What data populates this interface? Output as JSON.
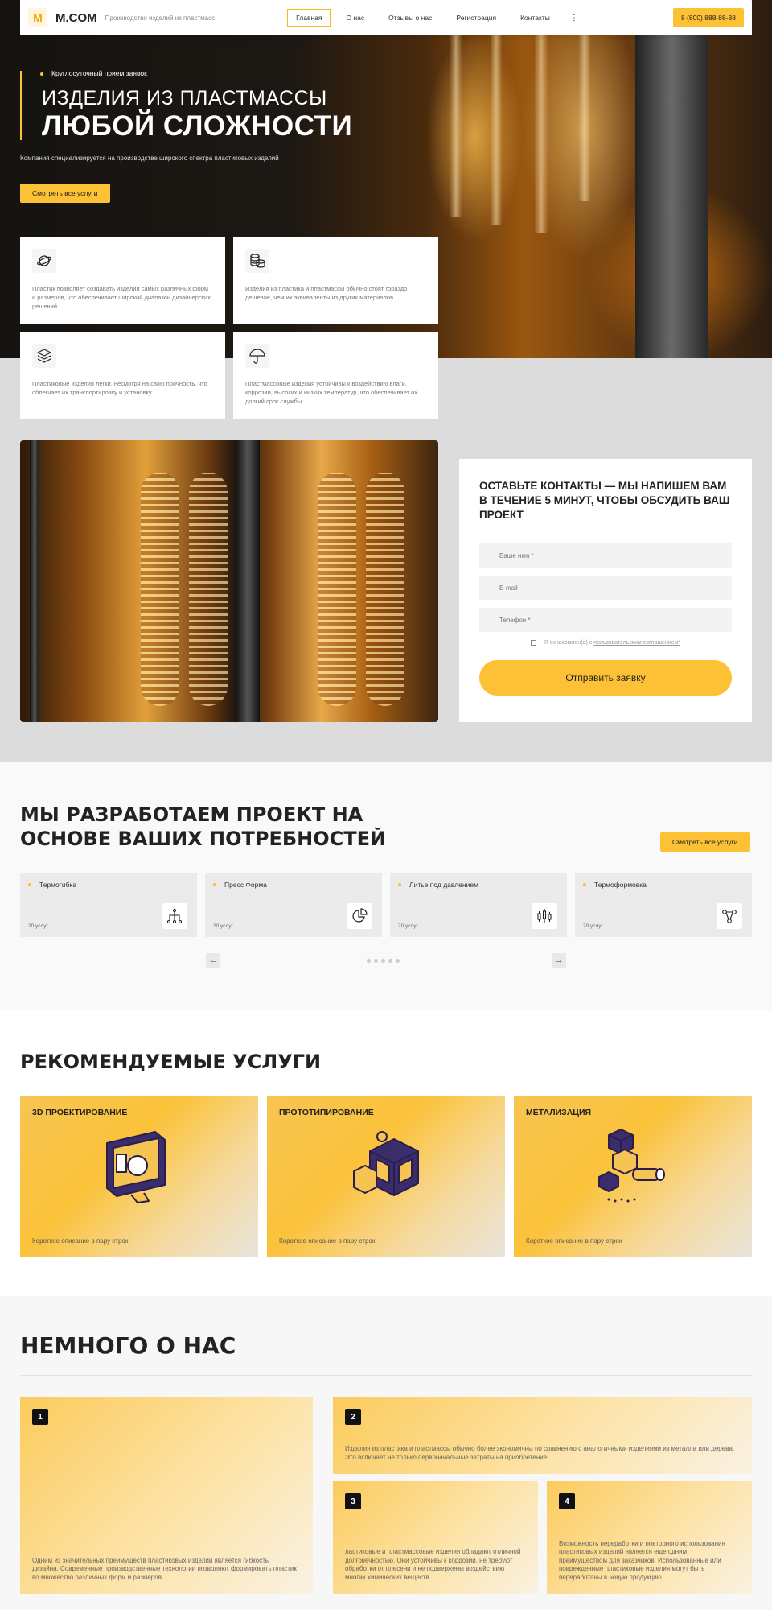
{
  "header": {
    "logo_mark": "M",
    "logo_text": "M.COM",
    "tagline": "Производство изделий из пластмасс",
    "nav": [
      "Главная",
      "О нас",
      "Отзывы о нас",
      "Регистрация",
      "Контакты"
    ],
    "more": "⋮",
    "phone": "8 (800) 888-88-88"
  },
  "hero": {
    "badge": "Круглосуточный прием заявок",
    "title_line1": "ИЗДЕЛИЯ ИЗ ПЛАСТМАССЫ",
    "title_line2": "ЛЮБОЙ СЛОЖНОСТИ",
    "description": "Компания специализируется на производстве широкого спектра пластиковых изделий",
    "button": "Смотреть все услуги"
  },
  "features": [
    {
      "icon": "planet-icon",
      "text": "Пластик позволяет создавать изделия самых различных форм и размеров, что обеспечивает широкий диапазон дизайнерских решений."
    },
    {
      "icon": "coins-icon",
      "text": "Изделия из пластика и пластмассы обычно стоят гораздо дешевле, чем их эквиваленты из других материалов."
    },
    {
      "icon": "layers-icon",
      "text": "Пластиковые изделия легки, несмотря на свою прочность, что облегчает их транспортировку и установку."
    },
    {
      "icon": "umbrella-icon",
      "text": "Пластмассовые изделия устойчивы к воздействию влаги, коррозии, высоких и низких температур, что обеспечивает их долгий срок службы."
    }
  ],
  "form": {
    "title": "ОСТАВЬТЕ КОНТАКТЫ — МЫ НАПИШЕМ ВАМ В ТЕЧЕНИЕ 5 МИНУТ, ЧТОБЫ ОБСУДИТЬ ВАШ ПРОЕКТ",
    "name_placeholder": "Ваше имя *",
    "email_placeholder": "E-mail",
    "phone_placeholder": "Телефон *",
    "consent_text": "Я ознакомлен(а) с",
    "consent_link": "пользовательским соглашением*",
    "submit": "Отправить заявку"
  },
  "projects": {
    "title_line1": "МЫ РАЗРАБОТАЕМ ПРОЕКТ НА",
    "title_line2": "ОСНОВЕ ВАШИХ ПОТРЕБНОСТЕЙ",
    "button": "Смотреть все услуги",
    "cards": [
      {
        "title": "Термогибка",
        "count": "20 услуг",
        "icon": "circuit-icon"
      },
      {
        "title": "Пресс Форма",
        "count": "20 услуг",
        "icon": "pie-chart-icon"
      },
      {
        "title": "Литье под давлением",
        "count": "20 услуг",
        "icon": "candlestick-icon"
      },
      {
        "title": "Термоформовка",
        "count": "20 услуг",
        "icon": "network-icon"
      }
    ],
    "prev": "←",
    "next": "→"
  },
  "services": {
    "title": "РЕКОМЕНДУЕМЫЕ УСЛУГИ",
    "cards": [
      {
        "title": "3D ПРОЕКТИРОВАНИЕ",
        "description": "Короткое описание в пару строк"
      },
      {
        "title": "ПРОТОТИПИРОВАНИЕ",
        "description": "Короткое описание в пару строк"
      },
      {
        "title": "МЕТАЛИЗАЦИЯ",
        "description": "Короткое описание в пару строк"
      }
    ]
  },
  "about": {
    "title": "НЕМНОГО О НАС",
    "cards": [
      {
        "num": "1",
        "text": "Одним из значительных преимуществ пластиковых изделий является гибкость дизайна. Современные производственные технологии позволяют формировать пластик во множество различных форм и размеров"
      },
      {
        "num": "2",
        "text": "Изделия из пластика и пластмассы обычно более экономичны по сравнению с аналогичными изделиями из металла или дерева. Это включает не только первоначальные затраты на приобретение"
      },
      {
        "num": "3",
        "text": "ластиковые и пластмассовые изделия обладают отличной долговечностью. Они устойчивы к коррозии, не требуют обработки от плесени и не подвержены воздействию многих химических веществ"
      },
      {
        "num": "4",
        "text": "Возможность переработки и повторного использования пластиковых изделий является еще одним преимуществом для заказчиков. Использованные или поврежденные пластиковые изделия могут быть переработаны в новую продукцию"
      }
    ]
  },
  "colors": {
    "accent": "#fcc134",
    "dark": "#111111"
  }
}
